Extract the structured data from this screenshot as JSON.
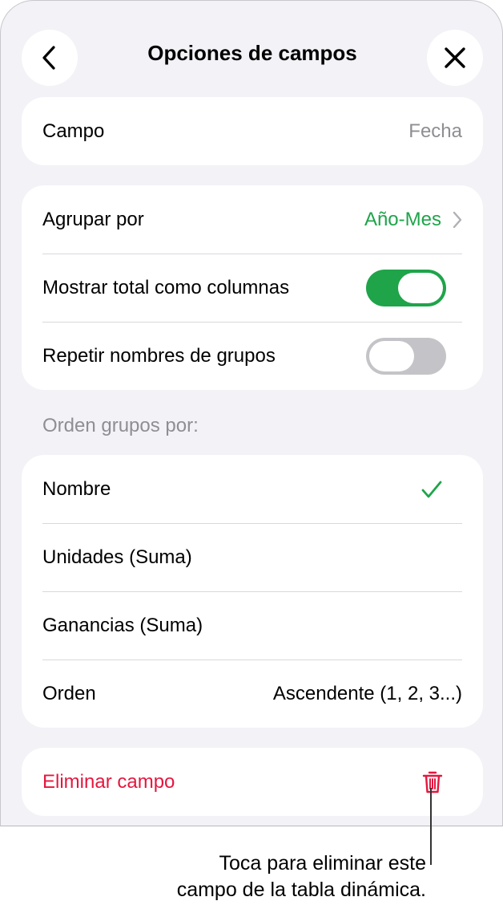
{
  "header": {
    "title": "Opciones de campos",
    "back_icon": "chevron-left-icon",
    "close_icon": "close-icon"
  },
  "field_card": {
    "label": "Campo",
    "value": "Fecha"
  },
  "grouping_card": {
    "group_by_label": "Agrupar por",
    "group_by_value": "Año-Mes",
    "show_totals_label": "Mostrar total como columnas",
    "show_totals_on": true,
    "repeat_names_label": "Repetir nombres de grupos",
    "repeat_names_on": false
  },
  "sort_section": {
    "header": "Orden grupos por:",
    "items": [
      {
        "label": "Nombre",
        "checked": true
      },
      {
        "label": "Unidades (Suma)",
        "checked": false
      },
      {
        "label": "Ganancias (Suma)",
        "checked": false
      }
    ],
    "order_label": "Orden",
    "order_value": "Ascendente (1, 2, 3...)"
  },
  "delete_card": {
    "label": "Eliminar campo",
    "icon": "trash-icon"
  },
  "callout": {
    "line1": "Toca para eliminar este",
    "line2": "campo de la tabla dinámica."
  },
  "colors": {
    "accent_green": "#1fa44a",
    "destructive_red": "#e5173f",
    "secondary_text": "#8e8e93",
    "background": "#f2f2f7"
  }
}
